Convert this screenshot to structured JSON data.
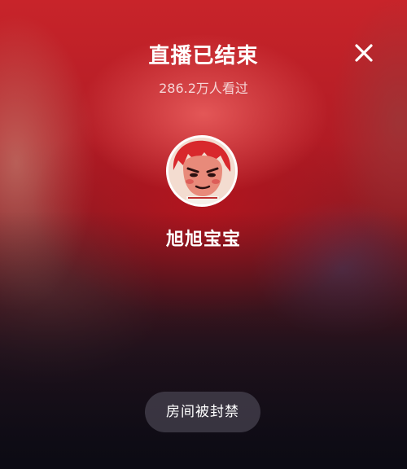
{
  "header": {
    "title": "直播已结束",
    "viewers": "286.2万人看过",
    "close_icon": "close-icon"
  },
  "streamer": {
    "name": "旭旭宝宝",
    "avatar_icon": "anime-face-avatar"
  },
  "status": {
    "label": "房间被封禁"
  },
  "colors": {
    "background_top": "#c8242a",
    "background_bottom": "#1a1220",
    "text": "#ffffff"
  }
}
